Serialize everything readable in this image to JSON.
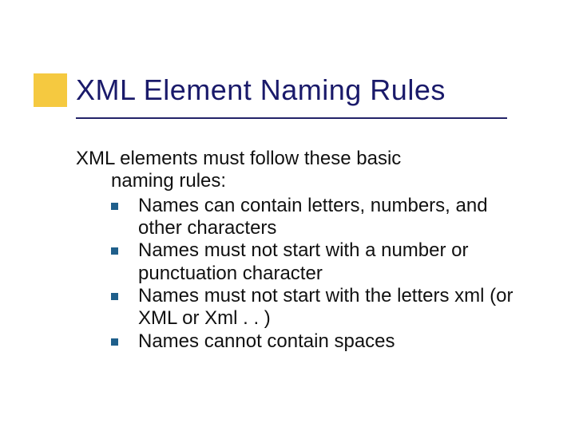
{
  "slide": {
    "title": "XML Element Naming Rules",
    "intro_line1": "XML elements must follow these basic",
    "intro_line2": "naming rules:",
    "bullets": [
      "Names can contain letters, numbers, and other characters",
      "Names must not start with a number or punctuation character",
      "Names must not start with the letters xml (or XML or Xml . . )",
      "Names cannot contain spaces"
    ]
  }
}
